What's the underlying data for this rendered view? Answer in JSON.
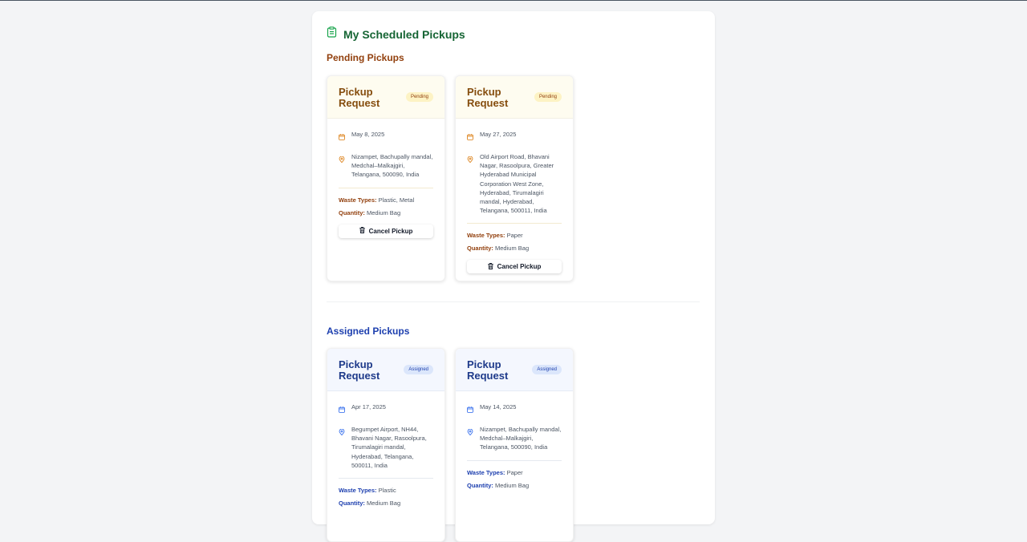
{
  "page": {
    "title": "My Scheduled Pickups",
    "icon": "clipboard-icon",
    "accent_color": "#166534"
  },
  "sections": {
    "pending": {
      "title": "Pending Pickups",
      "color": "#92400e",
      "cards": [
        {
          "title": "Pickup Request",
          "status": "Pending",
          "date": "May 8, 2025",
          "address": "Nizampet, Bachupally mandal, Medchal–Malkajgiri, Telangana, 500090, India",
          "waste_label": "Waste Types:",
          "waste_value": "Plastic, Metal",
          "quantity_label": "Quantity:",
          "quantity_value": "Medium Bag",
          "cancel_label": "Cancel Pickup"
        },
        {
          "title": "Pickup Request",
          "status": "Pending",
          "date": "May 27, 2025",
          "address": "Old Airport Road, Bhavani Nagar, Rasoolpura, Greater Hyderabad Municipal Corporation West Zone, Hyderabad, Tirumalagiri mandal, Hyderabad, Telangana, 500011, India",
          "waste_label": "Waste Types:",
          "waste_value": "Paper",
          "quantity_label": "Quantity:",
          "quantity_value": "Medium Bag",
          "cancel_label": "Cancel Pickup"
        }
      ]
    },
    "assigned": {
      "title": "Assigned Pickups",
      "color": "#1e40af",
      "cards": [
        {
          "title": "Pickup Request",
          "status": "Assigned",
          "date": "Apr 17, 2025",
          "address": "Begumpet Airport, NH44, Bhavani Nagar, Rasoolpura, Tirumalagiri mandal, Hyderabad, Telangana, 500011, India",
          "waste_label": "Waste Types:",
          "waste_value": "Plastic",
          "quantity_label": "Quantity:",
          "quantity_value": "Medium Bag"
        },
        {
          "title": "Pickup Request",
          "status": "Assigned",
          "date": "May 14, 2025",
          "address": "Nizampet, Bachupally mandal, Medchal–Malkajgiri, Telangana, 500090, India",
          "waste_label": "Waste Types:",
          "waste_value": "Paper",
          "quantity_label": "Quantity:",
          "quantity_value": "Medium Bag"
        }
      ]
    }
  }
}
